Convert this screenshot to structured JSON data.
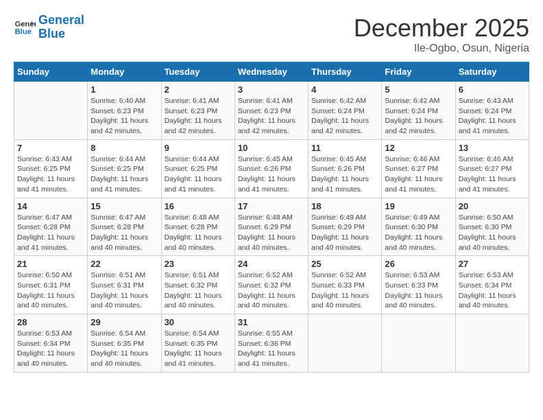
{
  "header": {
    "logo_line1": "General",
    "logo_line2": "Blue",
    "month": "December 2025",
    "location": "Ile-Ogbo, Osun, Nigeria"
  },
  "days_of_week": [
    "Sunday",
    "Monday",
    "Tuesday",
    "Wednesday",
    "Thursday",
    "Friday",
    "Saturday"
  ],
  "weeks": [
    [
      {
        "day": "",
        "info": ""
      },
      {
        "day": "1",
        "info": "Sunrise: 6:40 AM\nSunset: 6:23 PM\nDaylight: 11 hours and 42 minutes."
      },
      {
        "day": "2",
        "info": "Sunrise: 6:41 AM\nSunset: 6:23 PM\nDaylight: 11 hours and 42 minutes."
      },
      {
        "day": "3",
        "info": "Sunrise: 6:41 AM\nSunset: 6:23 PM\nDaylight: 11 hours and 42 minutes."
      },
      {
        "day": "4",
        "info": "Sunrise: 6:42 AM\nSunset: 6:24 PM\nDaylight: 11 hours and 42 minutes."
      },
      {
        "day": "5",
        "info": "Sunrise: 6:42 AM\nSunset: 6:24 PM\nDaylight: 11 hours and 42 minutes."
      },
      {
        "day": "6",
        "info": "Sunrise: 6:43 AM\nSunset: 6:24 PM\nDaylight: 11 hours and 41 minutes."
      }
    ],
    [
      {
        "day": "7",
        "info": "Sunrise: 6:43 AM\nSunset: 6:25 PM\nDaylight: 11 hours and 41 minutes."
      },
      {
        "day": "8",
        "info": "Sunrise: 6:44 AM\nSunset: 6:25 PM\nDaylight: 11 hours and 41 minutes."
      },
      {
        "day": "9",
        "info": "Sunrise: 6:44 AM\nSunset: 6:25 PM\nDaylight: 11 hours and 41 minutes."
      },
      {
        "day": "10",
        "info": "Sunrise: 6:45 AM\nSunset: 6:26 PM\nDaylight: 11 hours and 41 minutes."
      },
      {
        "day": "11",
        "info": "Sunrise: 6:45 AM\nSunset: 6:26 PM\nDaylight: 11 hours and 41 minutes."
      },
      {
        "day": "12",
        "info": "Sunrise: 6:46 AM\nSunset: 6:27 PM\nDaylight: 11 hours and 41 minutes."
      },
      {
        "day": "13",
        "info": "Sunrise: 6:46 AM\nSunset: 6:27 PM\nDaylight: 11 hours and 41 minutes."
      }
    ],
    [
      {
        "day": "14",
        "info": "Sunrise: 6:47 AM\nSunset: 6:28 PM\nDaylight: 11 hours and 41 minutes."
      },
      {
        "day": "15",
        "info": "Sunrise: 6:47 AM\nSunset: 6:28 PM\nDaylight: 11 hours and 40 minutes."
      },
      {
        "day": "16",
        "info": "Sunrise: 6:48 AM\nSunset: 6:28 PM\nDaylight: 11 hours and 40 minutes."
      },
      {
        "day": "17",
        "info": "Sunrise: 6:48 AM\nSunset: 6:29 PM\nDaylight: 11 hours and 40 minutes."
      },
      {
        "day": "18",
        "info": "Sunrise: 6:49 AM\nSunset: 6:29 PM\nDaylight: 11 hours and 40 minutes."
      },
      {
        "day": "19",
        "info": "Sunrise: 6:49 AM\nSunset: 6:30 PM\nDaylight: 11 hours and 40 minutes."
      },
      {
        "day": "20",
        "info": "Sunrise: 6:50 AM\nSunset: 6:30 PM\nDaylight: 11 hours and 40 minutes."
      }
    ],
    [
      {
        "day": "21",
        "info": "Sunrise: 6:50 AM\nSunset: 6:31 PM\nDaylight: 11 hours and 40 minutes."
      },
      {
        "day": "22",
        "info": "Sunrise: 6:51 AM\nSunset: 6:31 PM\nDaylight: 11 hours and 40 minutes."
      },
      {
        "day": "23",
        "info": "Sunrise: 6:51 AM\nSunset: 6:32 PM\nDaylight: 11 hours and 40 minutes."
      },
      {
        "day": "24",
        "info": "Sunrise: 6:52 AM\nSunset: 6:32 PM\nDaylight: 11 hours and 40 minutes."
      },
      {
        "day": "25",
        "info": "Sunrise: 6:52 AM\nSunset: 6:33 PM\nDaylight: 11 hours and 40 minutes."
      },
      {
        "day": "26",
        "info": "Sunrise: 6:53 AM\nSunset: 6:33 PM\nDaylight: 11 hours and 40 minutes."
      },
      {
        "day": "27",
        "info": "Sunrise: 6:53 AM\nSunset: 6:34 PM\nDaylight: 11 hours and 40 minutes."
      }
    ],
    [
      {
        "day": "28",
        "info": "Sunrise: 6:53 AM\nSunset: 6:34 PM\nDaylight: 11 hours and 40 minutes."
      },
      {
        "day": "29",
        "info": "Sunrise: 6:54 AM\nSunset: 6:35 PM\nDaylight: 11 hours and 40 minutes."
      },
      {
        "day": "30",
        "info": "Sunrise: 6:54 AM\nSunset: 6:35 PM\nDaylight: 11 hours and 41 minutes."
      },
      {
        "day": "31",
        "info": "Sunrise: 6:55 AM\nSunset: 6:36 PM\nDaylight: 11 hours and 41 minutes."
      },
      {
        "day": "",
        "info": ""
      },
      {
        "day": "",
        "info": ""
      },
      {
        "day": "",
        "info": ""
      }
    ]
  ]
}
